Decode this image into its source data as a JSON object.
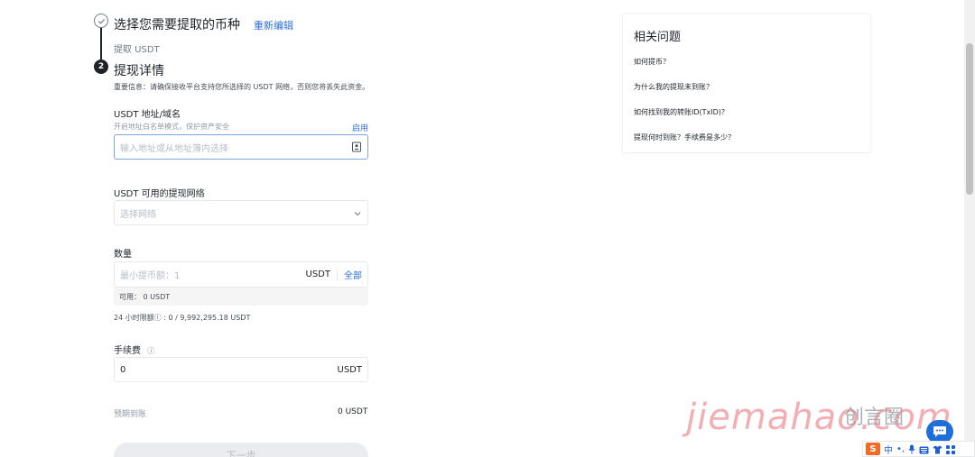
{
  "steps": {
    "step1_title": "选择您需要提取的币种",
    "re_edit": "重新编辑",
    "step1_sub": "提取 USDT",
    "step2_number": "2",
    "step2_title": "提现详情",
    "notice": "重要信息：请确保接收平台支持您所选择的 USDT 网络，否则您将丢失此资金。"
  },
  "address": {
    "label": "USDT 地址/域名",
    "hint": "开启地址白名单模式，保护资产安全",
    "enable_link": "启用",
    "placeholder": "输入地址或从地址簿内选择",
    "icon": "address-book-icon"
  },
  "network": {
    "label": "USDT 可用的提现网络",
    "placeholder": "选择网络",
    "icon": "chevron-down-icon"
  },
  "amount": {
    "label": "数量",
    "placeholder": "最小提币额：1",
    "unit": "USDT",
    "all_link": "全部",
    "available": "可用：  0 USDT",
    "limit": "24 小时限额ⓘ : 0 / 9,992,295.18 USDT"
  },
  "fee": {
    "label": "手续费",
    "info_icon": "ⓘ",
    "value": "0",
    "unit": "USDT"
  },
  "receive": {
    "label": "预期到账",
    "value": "0 USDT"
  },
  "next_button": "下一步",
  "faq": {
    "title": "相关问题",
    "items": [
      "如何提币？",
      "为什么我的提现未到账？",
      "如何找到我的转账ID(TxID)？",
      "提现何时到账？手续费是多少？"
    ]
  },
  "watermark": {
    "text": "jiemahao.com",
    "brand": "创言圈"
  },
  "ime": {
    "logo": "S",
    "mode": "中"
  },
  "colors": {
    "accent": "#2d6fdb",
    "text": "#1e2329",
    "muted": "#707a8a",
    "chat": "#1f6fdb"
  }
}
